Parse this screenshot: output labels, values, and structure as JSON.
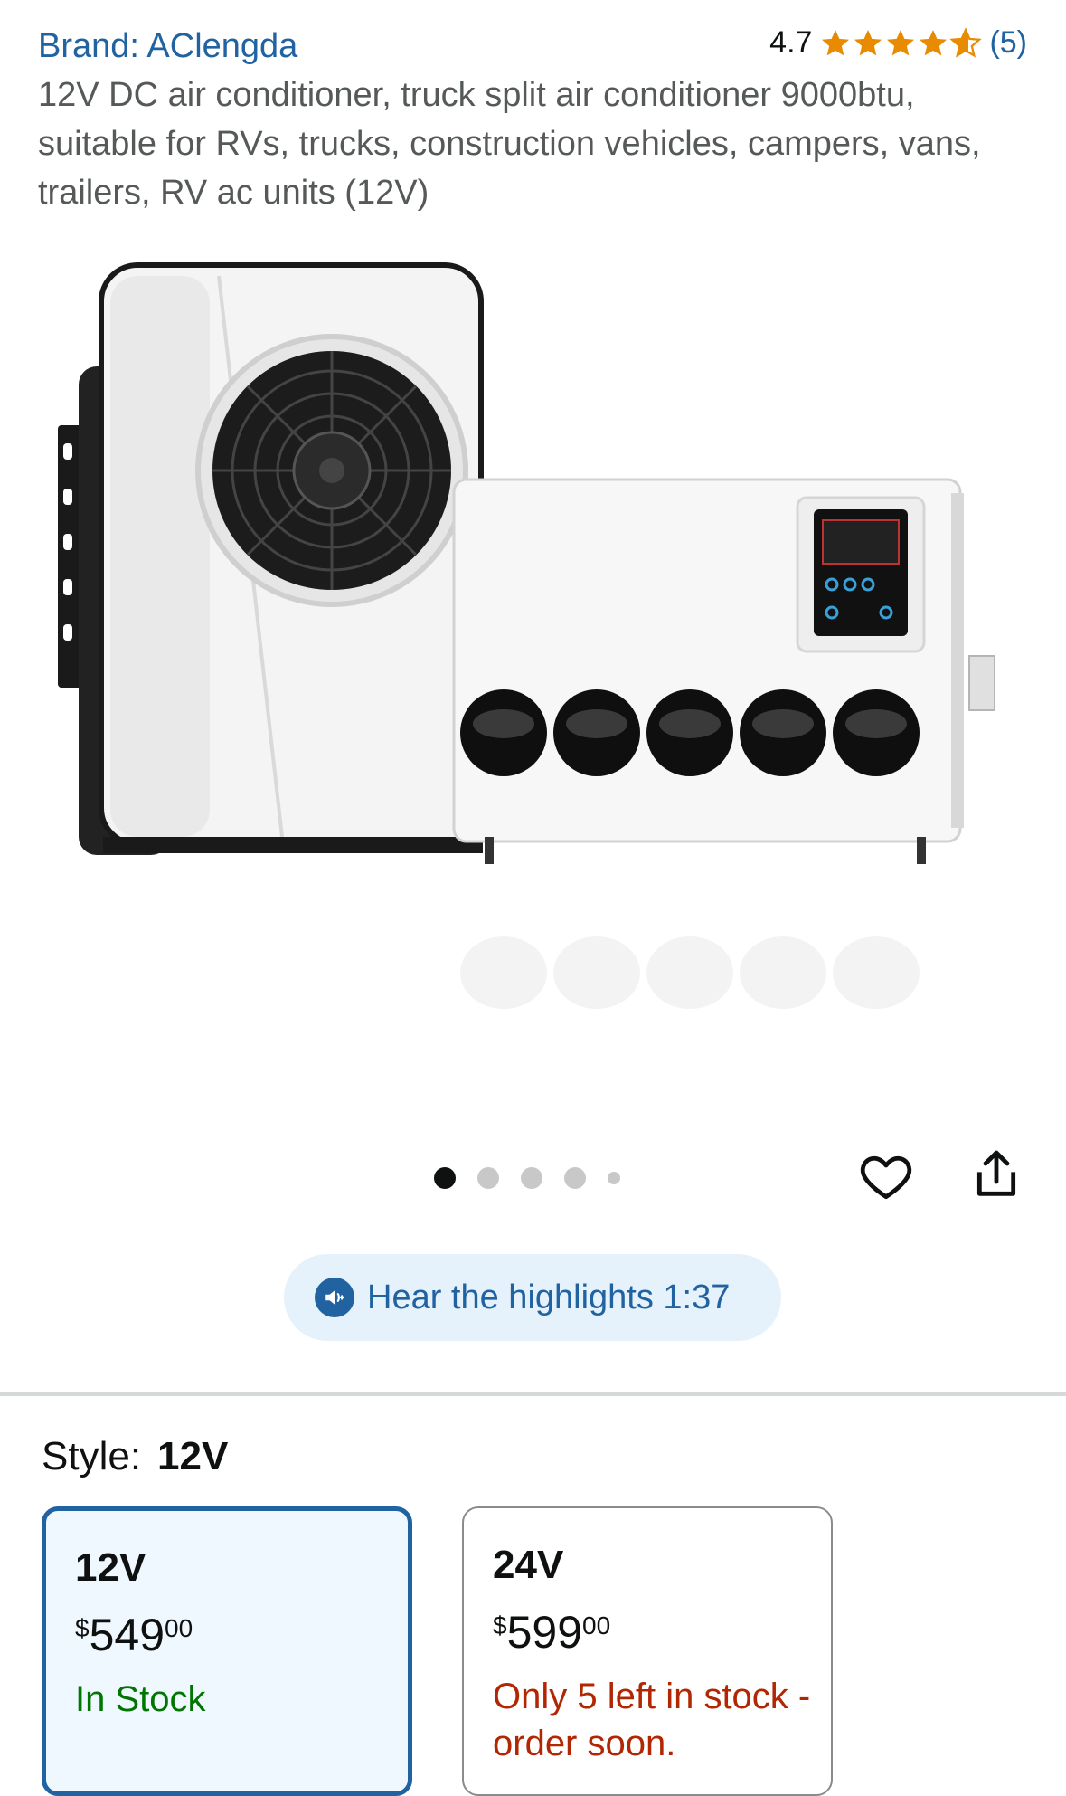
{
  "header": {
    "brand": "Brand: AClengda",
    "rating_value": "4.7",
    "rating_count": "(5)",
    "stars": 4.7,
    "title": "12V DC air conditioner, truck split air conditioner 9000btu, suitable for RVs, trucks, construction vehicles, campers, vans, trailers, RV ac units (12V)"
  },
  "gallery": {
    "image_count": 5,
    "active_index": 0,
    "favorite_icon": "heart-icon",
    "share_icon": "share-icon"
  },
  "audio": {
    "label": "Hear the highlights 1:37",
    "icon": "speaker-icon"
  },
  "style": {
    "label": "Style:",
    "selected": "12V",
    "options": [
      {
        "name": "12V",
        "currency": "$",
        "whole": "549",
        "fraction": "00",
        "stock": "In Stock",
        "stock_status": "in-stock"
      },
      {
        "name": "24V",
        "currency": "$",
        "whole": "599",
        "fraction": "00",
        "stock": "Only 5 left in stock - order soon.",
        "stock_status": "low-stock"
      }
    ]
  },
  "colors": {
    "link": "#2162a1",
    "star": "#e88b00",
    "in_stock": "#007600",
    "low_stock": "#b12704"
  }
}
